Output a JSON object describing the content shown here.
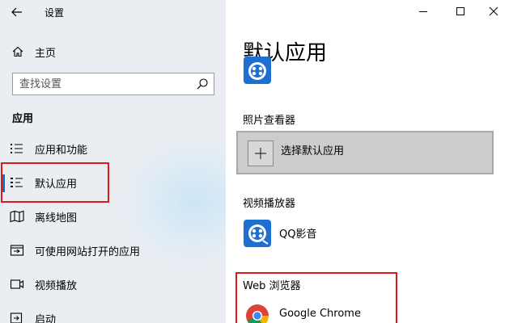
{
  "window": {
    "title": "设置"
  },
  "nav": {
    "home_label": "主页",
    "search": {
      "placeholder": "查找设置",
      "value": ""
    },
    "section_heading": "应用",
    "items": [
      {
        "label": "应用和功能",
        "icon": "apps-features-icon",
        "selected": false
      },
      {
        "label": "默认应用",
        "icon": "default-apps-icon",
        "selected": true
      },
      {
        "label": "离线地图",
        "icon": "offline-maps-icon",
        "selected": false
      },
      {
        "label": "可使用网站打开的应用",
        "icon": "apps-for-websites-icon",
        "selected": false
      },
      {
        "label": "视频播放",
        "icon": "video-playback-icon",
        "selected": false
      },
      {
        "label": "启动",
        "icon": "startup-icon",
        "selected": false
      }
    ]
  },
  "content": {
    "page_title": "默认应用",
    "photo_viewer": {
      "label": "照片查看器",
      "choose_label": "选择默认应用"
    },
    "video_player": {
      "label": "视频播放器",
      "app_name": "QQ影音"
    },
    "web_browser": {
      "label": "Web 浏览器",
      "app_name": "Google Chrome"
    }
  },
  "colors": {
    "accent": "#0078d7",
    "highlight": "#e0161e",
    "nav_bg": "#eaeef2"
  }
}
